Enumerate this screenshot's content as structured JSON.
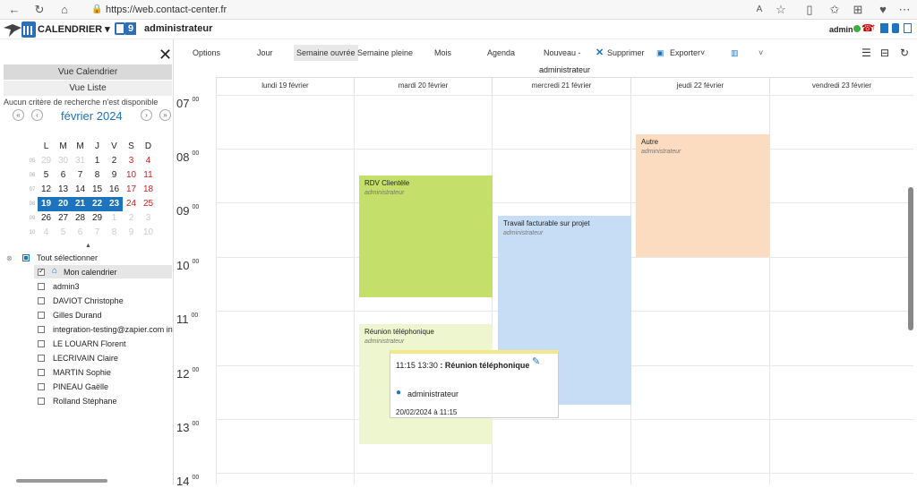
{
  "browser": {
    "url": "https://web.contact-center.fr"
  },
  "app": {
    "title": "CALENDRIER",
    "badge": "9",
    "user": "administrateur",
    "admin_label": "admin"
  },
  "sidebar": {
    "view_calendar": "Vue Calendrier",
    "view_list": "Vue Liste",
    "no_criteria": "Aucun critère de recherche n'est disponible",
    "month_title": "février 2024",
    "weekdays": [
      "L",
      "M",
      "M",
      "J",
      "V",
      "S",
      "D"
    ],
    "weeks": [
      {
        "wk": "05",
        "days": [
          "29",
          "30",
          "31",
          "1",
          "2",
          "3",
          "4"
        ]
      },
      {
        "wk": "06",
        "days": [
          "5",
          "6",
          "7",
          "8",
          "9",
          "10",
          "11"
        ]
      },
      {
        "wk": "07",
        "days": [
          "12",
          "13",
          "14",
          "15",
          "16",
          "17",
          "18"
        ]
      },
      {
        "wk": "08",
        "days": [
          "19",
          "20",
          "21",
          "22",
          "23",
          "24",
          "25"
        ]
      },
      {
        "wk": "09",
        "days": [
          "26",
          "27",
          "28",
          "29",
          "1",
          "2",
          "3"
        ]
      },
      {
        "wk": "10",
        "days": [
          "4",
          "5",
          "6",
          "7",
          "8",
          "9",
          "10"
        ]
      }
    ],
    "select_all": "Tout sélectionner",
    "people": [
      "Mon calendrier",
      "admin3",
      "DAVIOT Christophe",
      "Gilles Durand",
      "integration-testing@zapier.com inte",
      "LE LOUARN Florent",
      "LECRIVAIN Claire",
      "MARTIN Sophie",
      "PINEAU Gaëlle",
      "Rolland Stéphane"
    ]
  },
  "toolbar": {
    "options": "Options",
    "day": "Jour",
    "work_week": "Semaine ouvrée",
    "full_week": "Semaine pleine",
    "month": "Mois",
    "agenda": "Agenda",
    "new": "Nouveau",
    "delete": "Supprimer",
    "export": "Exporter"
  },
  "grid": {
    "owner": "administrateur",
    "days": [
      "lundi 19 février",
      "mardi 20 février",
      "mercredi 21 février",
      "jeudi 22 février",
      "vendredi 23 février"
    ],
    "hours": [
      "07",
      "08",
      "09",
      "10",
      "11",
      "12",
      "13",
      "14"
    ],
    "minutes": "00"
  },
  "events": {
    "rdv": {
      "title": "RDV Clientèle",
      "owner": "administrateur"
    },
    "travail": {
      "title": "Travail facturable sur projet",
      "owner": "administrateur"
    },
    "autre": {
      "title": "Autre",
      "owner": "administrateur"
    },
    "reunion": {
      "title": "Réunion téléphonique",
      "owner": "administrateur"
    }
  },
  "popup": {
    "time": "11:15 13:30",
    "title": ": Réunion téléphonique",
    "owner": "administrateur",
    "date": "20/02/2024 à 11:15"
  },
  "colors": {
    "green": "#c5e06a",
    "blue": "#c7ddf6",
    "orange": "#fcdcc0",
    "lightgreen": "#eef6cf",
    "accent": "#1c73be"
  }
}
